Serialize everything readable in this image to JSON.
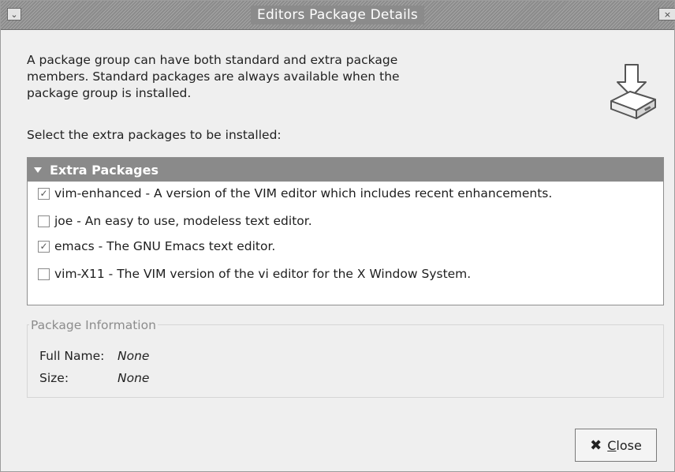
{
  "window": {
    "title": "Editors Package Details",
    "menu_icon": "chevron-down-icon",
    "close_icon": "close-icon"
  },
  "description": [
    "A package group can have both standard and extra package",
    "members.  Standard packages are always available when the",
    "package group is installed."
  ],
  "header_icon": "package-install-icon",
  "select_label": "Select the extra packages to be installed:",
  "tree": {
    "header": "Extra Packages",
    "items": [
      {
        "label": "vim-enhanced - A version of the VIM editor which includes recent enhancements.",
        "checked": true
      },
      {
        "label": "joe - An easy to use, modeless text editor.",
        "checked": false
      },
      {
        "label": "emacs - The GNU Emacs text editor.",
        "checked": true
      },
      {
        "label": "vim-X11 - The VIM version of the vi editor for the X Window System.",
        "checked": false
      }
    ]
  },
  "package_info": {
    "legend": "Package Information",
    "full_name_label": "Full Name:",
    "full_name_value": "None",
    "size_label": "Size:",
    "size_value": "None"
  },
  "close_button": {
    "label_prefix": "C",
    "label_rest": "lose",
    "icon": "close-x-icon"
  },
  "colors": {
    "dialog_bg": "#efefef",
    "header_bg": "#8a8a8a"
  }
}
